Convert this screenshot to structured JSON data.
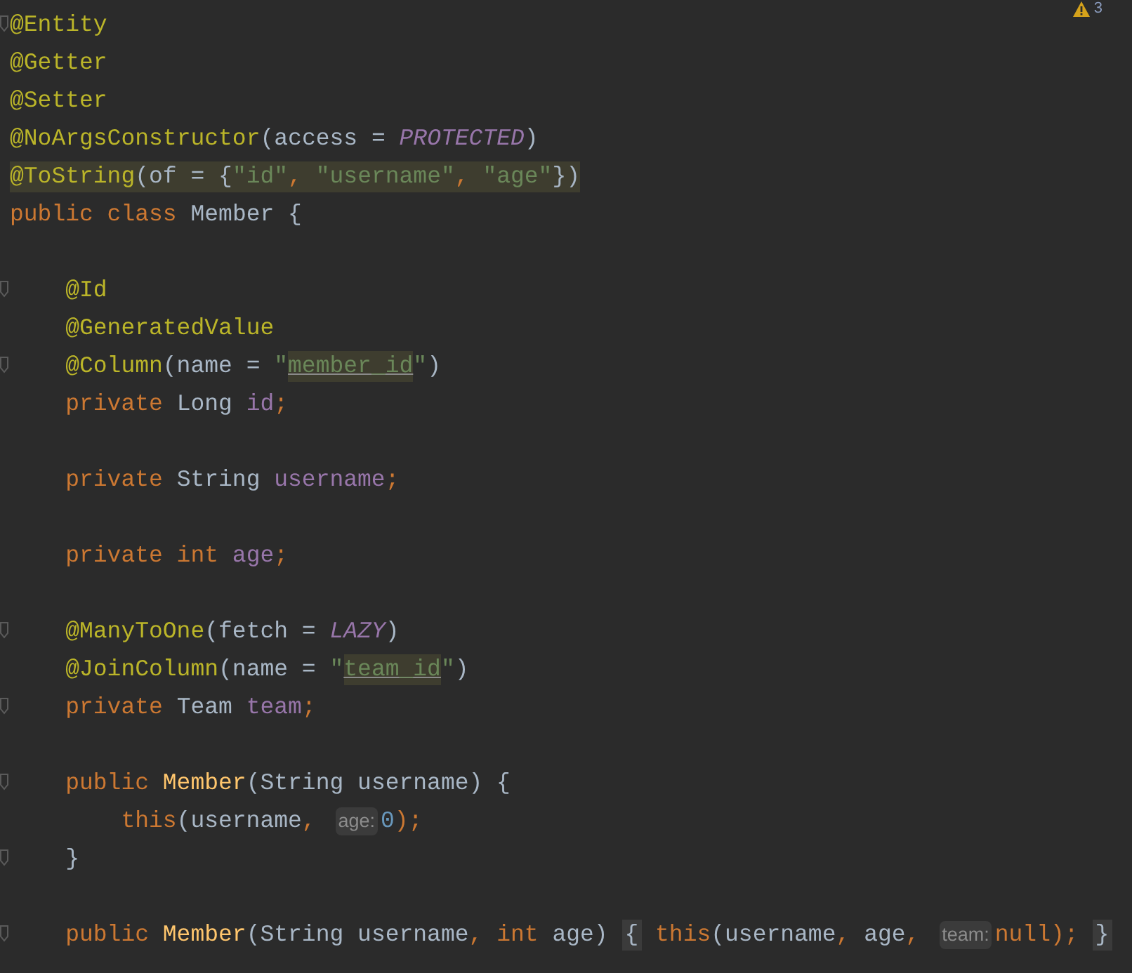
{
  "inspections": {
    "warning_count": "3"
  },
  "lines": [
    {
      "kind": "top",
      "fold": true,
      "highlighted": false,
      "tokens": [
        {
          "t": "@Entity",
          "kind": "annotation"
        }
      ]
    },
    {
      "kind": "top",
      "fold": false,
      "highlighted": false,
      "tokens": [
        {
          "t": "@Getter",
          "kind": "annotation"
        }
      ]
    },
    {
      "kind": "top",
      "fold": false,
      "highlighted": false,
      "tokens": [
        {
          "t": "@Setter",
          "kind": "annotation"
        }
      ]
    },
    {
      "kind": "top",
      "fold": false,
      "highlighted": false,
      "tokens": [
        {
          "t": "@NoArgsConstructor",
          "kind": "annotation"
        },
        {
          "t": "(access = ",
          "kind": "plain"
        },
        {
          "t": "PROTECTED",
          "kind": "constant"
        },
        {
          "t": ")",
          "kind": "plain"
        }
      ]
    },
    {
      "kind": "top",
      "fold": false,
      "highlighted": true,
      "tokens": [
        {
          "t": "@ToString",
          "kind": "annotation"
        },
        {
          "t": "(of = {",
          "kind": "plain"
        },
        {
          "t": "\"id\"",
          "kind": "string"
        },
        {
          "t": ", ",
          "kind": "keyword"
        },
        {
          "t": "\"username\"",
          "kind": "string"
        },
        {
          "t": ", ",
          "kind": "keyword"
        },
        {
          "t": "\"age\"",
          "kind": "string"
        },
        {
          "t": "})",
          "kind": "plain"
        }
      ]
    },
    {
      "kind": "top",
      "fold": false,
      "highlighted": false,
      "tokens": [
        {
          "t": "public class ",
          "kind": "keyword"
        },
        {
          "t": "Member {",
          "kind": "plain"
        }
      ]
    },
    {
      "kind": "top",
      "fold": false,
      "highlighted": false
    },
    {
      "kind": "member",
      "fold": true,
      "highlighted": false,
      "tokens": [
        {
          "t": "@Id",
          "kind": "annotation"
        }
      ]
    },
    {
      "kind": "member",
      "fold": false,
      "highlighted": false,
      "tokens": [
        {
          "t": "@GeneratedValue",
          "kind": "annotation"
        }
      ]
    },
    {
      "kind": "member",
      "fold": true,
      "highlighted": false,
      "tokens": [
        {
          "t": "@Column",
          "kind": "annotation"
        },
        {
          "t": "(name = ",
          "kind": "plain"
        },
        {
          "t": "\"",
          "kind": "string"
        },
        {
          "t": "member_id",
          "kind": "reference"
        },
        {
          "t": "\"",
          "kind": "string"
        },
        {
          "t": ")",
          "kind": "plain"
        }
      ]
    },
    {
      "kind": "member",
      "fold": false,
      "highlighted": false,
      "tokens": [
        {
          "t": "private ",
          "kind": "keyword"
        },
        {
          "t": "Long ",
          "kind": "plain"
        },
        {
          "t": "id",
          "kind": "field"
        },
        {
          "t": ";",
          "kind": "keyword"
        }
      ]
    },
    {
      "kind": "top",
      "fold": false,
      "highlighted": false
    },
    {
      "kind": "member",
      "fold": false,
      "highlighted": false,
      "tokens": [
        {
          "t": "private ",
          "kind": "keyword"
        },
        {
          "t": "String ",
          "kind": "plain"
        },
        {
          "t": "username",
          "kind": "field"
        },
        {
          "t": ";",
          "kind": "keyword"
        }
      ]
    },
    {
      "kind": "top",
      "fold": false,
      "highlighted": false
    },
    {
      "kind": "member",
      "fold": false,
      "highlighted": false,
      "tokens": [
        {
          "t": "private int ",
          "kind": "keyword"
        },
        {
          "t": "age",
          "kind": "field"
        },
        {
          "t": ";",
          "kind": "keyword"
        }
      ]
    },
    {
      "kind": "top",
      "fold": false,
      "highlighted": false
    },
    {
      "kind": "member",
      "fold": true,
      "highlighted": false,
      "tokens": [
        {
          "t": "@ManyToOne",
          "kind": "annotation"
        },
        {
          "t": "(fetch = ",
          "kind": "plain"
        },
        {
          "t": "LAZY",
          "kind": "constant"
        },
        {
          "t": ")",
          "kind": "plain"
        }
      ]
    },
    {
      "kind": "member",
      "fold": false,
      "highlighted": false,
      "tokens": [
        {
          "t": "@JoinColumn",
          "kind": "annotation"
        },
        {
          "t": "(name = ",
          "kind": "plain"
        },
        {
          "t": "\"",
          "kind": "string"
        },
        {
          "t": "team_id",
          "kind": "reference"
        },
        {
          "t": "\"",
          "kind": "string"
        },
        {
          "t": ")",
          "kind": "plain"
        }
      ]
    },
    {
      "kind": "member",
      "fold": true,
      "highlighted": false,
      "tokens": [
        {
          "t": "private ",
          "kind": "keyword"
        },
        {
          "t": "Team ",
          "kind": "plain"
        },
        {
          "t": "team",
          "kind": "field"
        },
        {
          "t": ";",
          "kind": "keyword"
        }
      ]
    },
    {
      "kind": "top",
      "fold": false,
      "highlighted": false
    },
    {
      "kind": "member",
      "fold": true,
      "highlighted": false,
      "tokens": [
        {
          "t": "public ",
          "kind": "keyword"
        },
        {
          "t": "Member",
          "kind": "method"
        },
        {
          "t": "(String username) {",
          "kind": "plain"
        }
      ]
    },
    {
      "kind": "statement",
      "fold": false,
      "highlighted": false,
      "tokens": [
        {
          "t": "this",
          "kind": "keyword"
        },
        {
          "t": "(username",
          "kind": "plain"
        },
        {
          "t": ", ",
          "kind": "keyword"
        },
        {
          "t": "age:",
          "kind": "hint"
        },
        {
          "t": "0",
          "kind": "number"
        },
        {
          "t": ");",
          "kind": "keyword"
        }
      ]
    },
    {
      "kind": "member",
      "fold": true,
      "highlighted": false,
      "tokens": [
        {
          "t": "}",
          "kind": "plain"
        }
      ]
    },
    {
      "kind": "top",
      "fold": false,
      "highlighted": false
    },
    {
      "kind": "member",
      "fold": true,
      "highlighted": false,
      "tokens": [
        {
          "t": "public ",
          "kind": "keyword"
        },
        {
          "t": "Member",
          "kind": "method"
        },
        {
          "t": "(String username",
          "kind": "plain"
        },
        {
          "t": ", ",
          "kind": "keyword"
        },
        {
          "t": "int ",
          "kind": "keyword"
        },
        {
          "t": "age) ",
          "kind": "plain"
        },
        {
          "t": "{",
          "kind": "folded"
        },
        {
          "t": " this",
          "kind": "keyword"
        },
        {
          "t": "(username",
          "kind": "plain"
        },
        {
          "t": ", ",
          "kind": "keyword"
        },
        {
          "t": "age",
          "kind": "plain"
        },
        {
          "t": ", ",
          "kind": "keyword"
        },
        {
          "t": "team:",
          "kind": "hint"
        },
        {
          "t": "null",
          "kind": "keyword"
        },
        {
          "t": "); ",
          "kind": "keyword"
        },
        {
          "t": "}",
          "kind": "folded"
        }
      ]
    }
  ]
}
